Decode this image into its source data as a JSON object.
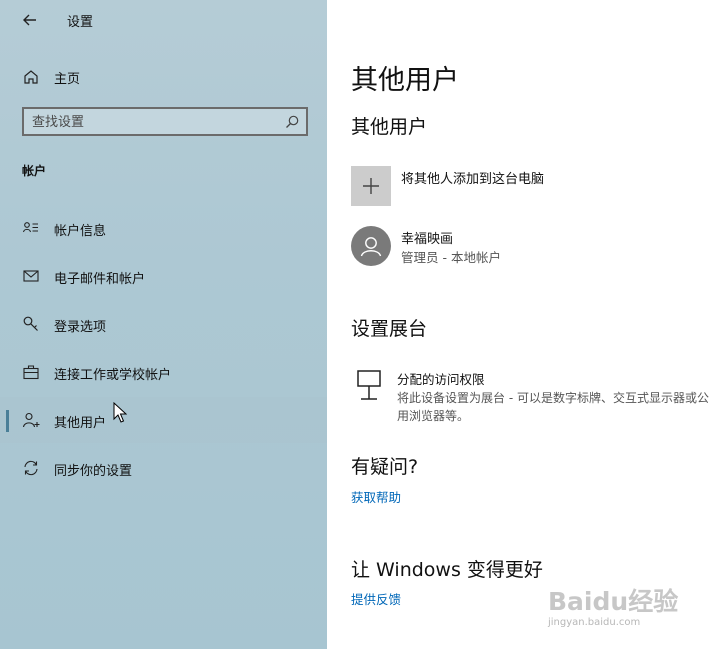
{
  "window": {
    "title": "设置"
  },
  "sidebar": {
    "home_label": "主页",
    "search": {
      "placeholder": "查找设置"
    },
    "section_title": "帐户",
    "items": [
      {
        "label": "帐户信息",
        "icon": "account-info-icon",
        "active": false
      },
      {
        "label": "电子邮件和帐户",
        "icon": "mail-icon",
        "active": false
      },
      {
        "label": "登录选项",
        "icon": "key-icon",
        "active": false
      },
      {
        "label": "连接工作或学校帐户",
        "icon": "briefcase-icon",
        "active": false
      },
      {
        "label": "其他用户",
        "icon": "add-person-icon",
        "active": true
      },
      {
        "label": "同步你的设置",
        "icon": "sync-icon",
        "active": false
      }
    ]
  },
  "main": {
    "page_title": "其他用户",
    "other_users": {
      "heading": "其他用户",
      "add_label": "将其他人添加到这台电脑",
      "user": {
        "name": "幸福映画",
        "role": "管理员 - 本地帐户"
      }
    },
    "kiosk": {
      "heading": "设置展台",
      "title": "分配的访问权限",
      "description": "将此设备设置为展台 - 可以是数字标牌、交互式显示器或公用浏览器等。"
    },
    "help": {
      "heading": "有疑问?",
      "link": "获取帮助"
    },
    "feedback": {
      "heading": "让 Windows 变得更好",
      "link": "提供反馈"
    }
  },
  "watermark": {
    "text": "Baidu经验",
    "sub": "jingyan.baidu.com"
  },
  "colors": {
    "accent": "#0067b8",
    "sidebar_bg": "#adc8d3",
    "active_indicator": "#4a7f98"
  }
}
